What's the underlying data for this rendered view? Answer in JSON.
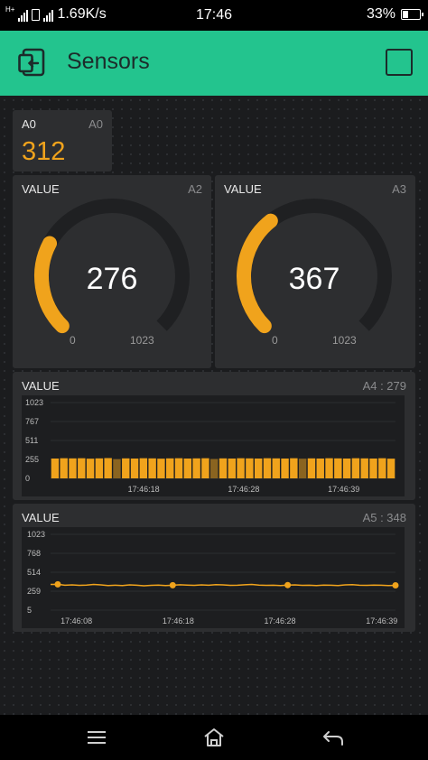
{
  "status_bar": {
    "network_type": "H+",
    "speed": "1.69K/s",
    "time": "17:46",
    "battery": "33%"
  },
  "header": {
    "title": "Sensors",
    "color": "#23c48e"
  },
  "value_display": {
    "label": "A0",
    "pin": "A0",
    "value": "312",
    "value_color": "#f0a31c"
  },
  "gauges": [
    {
      "label": "VALUE",
      "pin": "A2",
      "value": "276",
      "value_num": 276,
      "min": "0",
      "max": "1023",
      "max_num": 1023
    },
    {
      "label": "VALUE",
      "pin": "A3",
      "value": "367",
      "value_num": 367,
      "min": "0",
      "max": "1023",
      "max_num": 1023
    }
  ],
  "bar_chart_widget": {
    "label": "VALUE",
    "pin": "A4 : 279"
  },
  "line_chart_widget": {
    "label": "VALUE",
    "pin": "A5 : 348"
  },
  "chart_data": [
    {
      "type": "bar",
      "yticks": [
        "1023",
        "767",
        "511",
        "255",
        "0"
      ],
      "ylim": [
        0,
        1023
      ],
      "xticks": [
        "17:46:18",
        "17:46:28",
        "17:46:39"
      ],
      "color": "#f0a31c",
      "highlight_color": "#8a6420",
      "values": [
        268,
        272,
        270,
        272,
        266,
        270,
        274,
        260,
        270,
        268,
        272,
        270,
        266,
        270,
        272,
        268,
        270,
        272,
        262,
        270,
        268,
        272,
        270,
        268,
        272,
        270,
        268,
        272,
        266,
        270,
        268,
        272,
        270,
        268,
        272,
        270,
        268,
        272,
        266
      ],
      "highlighted_indices": [
        7,
        18,
        28
      ]
    },
    {
      "type": "line",
      "yticks": [
        "1023",
        "768",
        "514",
        "259",
        "5"
      ],
      "ylim": [
        5,
        1023
      ],
      "xticks": [
        "17:46:08",
        "17:46:18",
        "17:46:28",
        "17:46:39"
      ],
      "color": "#f0a31c",
      "values": [
        350,
        352,
        340,
        345,
        338,
        342,
        350,
        344,
        335,
        340,
        336,
        345,
        340,
        332,
        338,
        342,
        335,
        340,
        346,
        342,
        338,
        344,
        340,
        348,
        345,
        338,
        340,
        346,
        350,
        342,
        338,
        340,
        336,
        342,
        345,
        338,
        340,
        335,
        342,
        340,
        336,
        344,
        348,
        340,
        338,
        342,
        340,
        335,
        338
      ],
      "marker_indices": [
        1,
        17,
        33,
        49
      ]
    }
  ]
}
